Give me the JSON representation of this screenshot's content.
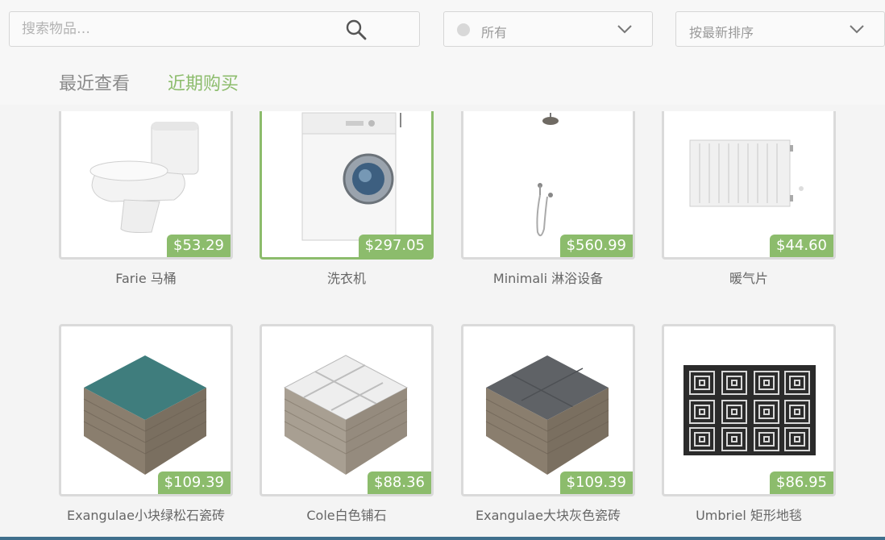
{
  "search": {
    "placeholder": "搜索物品…"
  },
  "filter": {
    "selected": "所有"
  },
  "sort": {
    "selected": "按最新排序"
  },
  "tabs": [
    {
      "label": "最近查看",
      "active": false
    },
    {
      "label": "近期购买",
      "active": true
    }
  ],
  "colors": {
    "accent": "#8cbc6c",
    "border": "#dadada",
    "bottom_bar": "#3f6f8c"
  },
  "items": [
    {
      "name": "Farie 马桶",
      "price": "$53.29",
      "icon": "toilet-icon",
      "selected": false
    },
    {
      "name": "洗衣机",
      "price": "$297.05",
      "icon": "washing-machine-icon",
      "selected": true
    },
    {
      "name": "Minimali 淋浴设备",
      "price": "$560.99",
      "icon": "shower-icon",
      "selected": false
    },
    {
      "name": "暖气片",
      "price": "$44.60",
      "icon": "radiator-icon",
      "selected": false
    },
    {
      "name": "Exangulae小块绿松石瓷砖",
      "price": "$109.39",
      "icon": "turquoise-tile-icon",
      "selected": false
    },
    {
      "name": "Cole白色铺石",
      "price": "$88.36",
      "icon": "white-paver-icon",
      "selected": false
    },
    {
      "name": "Exangulae大块灰色瓷砖",
      "price": "$109.39",
      "icon": "grey-tile-icon",
      "selected": false
    },
    {
      "name": "Umbriel 矩形地毯",
      "price": "$86.95",
      "icon": "rug-icon",
      "selected": false
    }
  ]
}
